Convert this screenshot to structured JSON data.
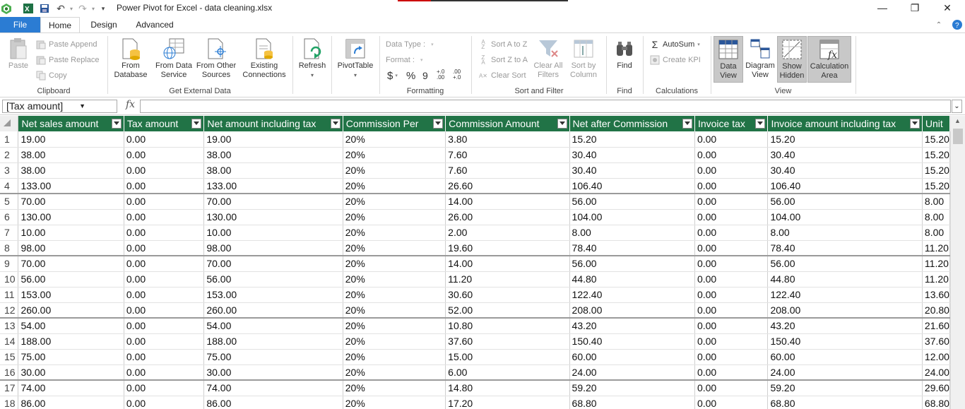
{
  "window": {
    "title": "Power Pivot for Excel - data cleaning.xlsx",
    "minimize": "—",
    "restore": "❐",
    "close": "✕"
  },
  "tabs": [
    "File",
    "Home",
    "Design",
    "Advanced"
  ],
  "ribbon": {
    "clipboard": {
      "paste": "Paste",
      "paste_append": "Paste Append",
      "paste_replace": "Paste Replace",
      "copy": "Copy",
      "label": "Clipboard"
    },
    "external": {
      "from_database": "From Database",
      "from_data_service": "From Data Service",
      "from_other_sources": "From Other Sources",
      "existing_connections": "Existing Connections",
      "label": "Get External Data"
    },
    "refresh": "Refresh",
    "pivottable": "PivotTable",
    "formatting": {
      "data_type": "Data Type :",
      "format": "Format :",
      "currency": "$",
      "percent": "%",
      "comma": "9",
      "inc_dec": "+.0 .00",
      "dec_dec": ".00 +.0",
      "label": "Formatting"
    },
    "sort_filter": {
      "sort_az": "Sort A to Z",
      "sort_za": "Sort Z to A",
      "clear_sort": "Clear Sort",
      "clear_all_filters": "Clear All Filters",
      "sort_by_column": "Sort by Column",
      "label": "Sort and Filter"
    },
    "find": {
      "find": "Find",
      "label": "Find"
    },
    "calculations": {
      "autosum": "AutoSum",
      "create_kpi": "Create KPI",
      "label": "Calculations"
    },
    "view": {
      "data_view": "Data View",
      "diagram_view": "Diagram View",
      "show_hidden": "Show Hidden",
      "calculation_area": "Calculation Area",
      "label": "View"
    }
  },
  "formula_bar": {
    "name_box": "[Tax amount]",
    "fx": "fx",
    "formula": ""
  },
  "columns": [
    "Net sales amount",
    "Tax amount",
    "Net amount including tax",
    "Commission Per",
    "Commission Amount",
    "Net after Commission",
    "Invoice tax",
    "Invoice amount including tax",
    "Unit"
  ],
  "rows": [
    [
      "1",
      "19.00",
      "0.00",
      "19.00",
      "20%",
      "3.80",
      "15.20",
      "0.00",
      "15.20",
      "15.20"
    ],
    [
      "2",
      "38.00",
      "0.00",
      "38.00",
      "20%",
      "7.60",
      "30.40",
      "0.00",
      "30.40",
      "15.20"
    ],
    [
      "3",
      "38.00",
      "0.00",
      "38.00",
      "20%",
      "7.60",
      "30.40",
      "0.00",
      "30.40",
      "15.20"
    ],
    [
      "4",
      "133.00",
      "0.00",
      "133.00",
      "20%",
      "26.60",
      "106.40",
      "0.00",
      "106.40",
      "15.20"
    ],
    [
      "5",
      "70.00",
      "0.00",
      "70.00",
      "20%",
      "14.00",
      "56.00",
      "0.00",
      "56.00",
      "8.00"
    ],
    [
      "6",
      "130.00",
      "0.00",
      "130.00",
      "20%",
      "26.00",
      "104.00",
      "0.00",
      "104.00",
      "8.00"
    ],
    [
      "7",
      "10.00",
      "0.00",
      "10.00",
      "20%",
      "2.00",
      "8.00",
      "0.00",
      "8.00",
      "8.00"
    ],
    [
      "8",
      "98.00",
      "0.00",
      "98.00",
      "20%",
      "19.60",
      "78.40",
      "0.00",
      "78.40",
      "11.20"
    ],
    [
      "9",
      "70.00",
      "0.00",
      "70.00",
      "20%",
      "14.00",
      "56.00",
      "0.00",
      "56.00",
      "11.20"
    ],
    [
      "10",
      "56.00",
      "0.00",
      "56.00",
      "20%",
      "11.20",
      "44.80",
      "0.00",
      "44.80",
      "11.20"
    ],
    [
      "11",
      "153.00",
      "0.00",
      "153.00",
      "20%",
      "30.60",
      "122.40",
      "0.00",
      "122.40",
      "13.60"
    ],
    [
      "12",
      "260.00",
      "0.00",
      "260.00",
      "20%",
      "52.00",
      "208.00",
      "0.00",
      "208.00",
      "20.80"
    ],
    [
      "13",
      "54.00",
      "0.00",
      "54.00",
      "20%",
      "10.80",
      "43.20",
      "0.00",
      "43.20",
      "21.60"
    ],
    [
      "14",
      "188.00",
      "0.00",
      "188.00",
      "20%",
      "37.60",
      "150.40",
      "0.00",
      "150.40",
      "37.60"
    ],
    [
      "15",
      "75.00",
      "0.00",
      "75.00",
      "20%",
      "15.00",
      "60.00",
      "0.00",
      "60.00",
      "12.00"
    ],
    [
      "16",
      "30.00",
      "0.00",
      "30.00",
      "20%",
      "6.00",
      "24.00",
      "0.00",
      "24.00",
      "24.00"
    ],
    [
      "17",
      "74.00",
      "0.00",
      "74.00",
      "20%",
      "14.80",
      "59.20",
      "0.00",
      "59.20",
      "29.60"
    ],
    [
      "18",
      "86.00",
      "0.00",
      "86.00",
      "20%",
      "17.20",
      "68.80",
      "0.00",
      "68.80",
      "68.80"
    ]
  ],
  "thick_after_rows": [
    4,
    8,
    12,
    16
  ],
  "colors": {
    "header_green": "#217346",
    "file_blue": "#2b7cd3"
  }
}
